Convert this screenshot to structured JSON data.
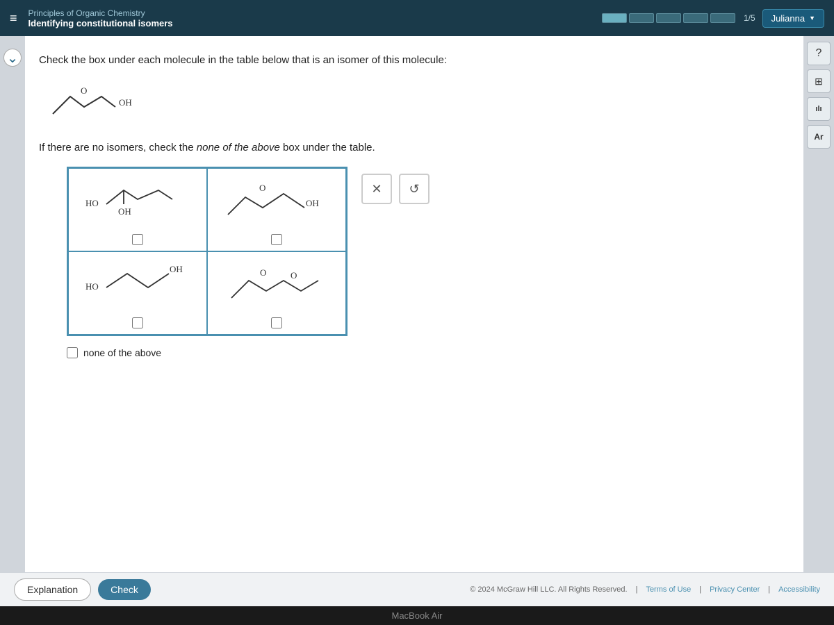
{
  "header": {
    "course": "Principles of Organic Chemistry",
    "subtitle": "Identifying constitutional isomers",
    "progress_label": "1/5",
    "user": "Julianna",
    "menu_icon": "≡",
    "chevron": "▼"
  },
  "question": {
    "text": "Check the box under each molecule in the table below that is an isomer of this molecule:",
    "note": "If there are no isomers, check the ",
    "note_em": "none of the above",
    "note_end": " box under the table."
  },
  "molecules": {
    "cell1_label": "molecule-1",
    "cell2_label": "molecule-2",
    "cell3_label": "molecule-3",
    "cell4_label": "molecule-4"
  },
  "none_above_label": "none of the above",
  "footer": {
    "explanation_label": "Explanation",
    "check_label": "Check",
    "copyright": "© 2024 McGraw Hill LLC. All Rights Reserved.",
    "terms": "Terms of Use",
    "privacy": "Privacy Center",
    "accessibility": "Accessibility"
  },
  "macbook": "MacBook Air",
  "right_sidebar": {
    "help_icon": "?",
    "table_icon": "⊞",
    "chart_icon": "⬛",
    "text_icon": "Ar"
  },
  "action_buttons": {
    "close": "✕",
    "refresh": "↺"
  }
}
